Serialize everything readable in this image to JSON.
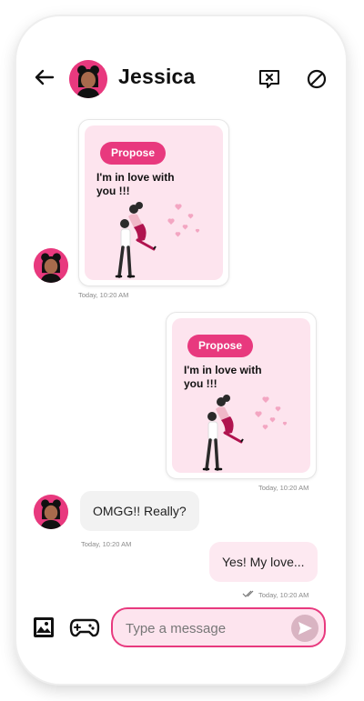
{
  "header": {
    "contact_name": "Jessica",
    "icons": [
      "back-arrow-icon",
      "avatar",
      "report-message-icon",
      "block-icon"
    ]
  },
  "messages": [
    {
      "type": "propose-card",
      "direction": "incoming",
      "pill_label": "Propose",
      "text": "I'm in love with you !!!",
      "time": "Today, 10:20 AM"
    },
    {
      "type": "propose-card",
      "direction": "outgoing",
      "pill_label": "Propose",
      "text": "I'm in love with you !!!",
      "time": "Today, 10:20 AM"
    },
    {
      "type": "text",
      "direction": "incoming",
      "text": "OMGG!! Really?",
      "time": "Today, 10:20 AM"
    },
    {
      "type": "text",
      "direction": "outgoing",
      "text": "Yes! My love...",
      "time": "Today, 10:20 AM",
      "status": "read"
    }
  ],
  "composer": {
    "placeholder": "Type a message",
    "icons": [
      "image-icon",
      "gamepad-icon",
      "send-icon"
    ]
  },
  "colors": {
    "accent": "#e8397e",
    "card_bg": "#fde4ee",
    "bubble_in": "#f2f2f2",
    "bubble_out": "#fde9f1"
  }
}
